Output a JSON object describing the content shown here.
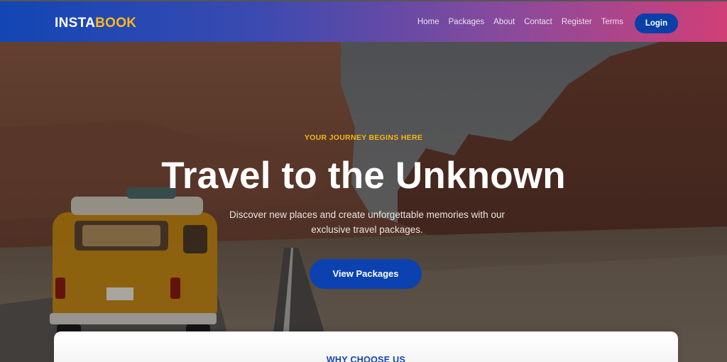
{
  "navbar": {
    "brand_part1": "INSTA",
    "brand_part2": "BOOK",
    "links": [
      "Home",
      "Packages",
      "About",
      "Contact",
      "Register",
      "Terms"
    ],
    "login_label": "Login"
  },
  "hero": {
    "eyebrow": "YOUR JOURNEY BEGINS HERE",
    "title": "Travel to the Unknown",
    "subtitle": "Discover new places and create unforgettable memories with our exclusive travel packages.",
    "cta_label": "View Packages",
    "background_image": "desert-road-camper-van-photo"
  },
  "features": {
    "heading": "WHY CHOOSE US"
  },
  "colors": {
    "accent_blue": "#0b42b0",
    "brand_yellow": "#ffb81c",
    "eyebrow_yellow": "#f4b617",
    "nav_gradient_start": "#1246b5",
    "nav_gradient_end": "#d03f77"
  }
}
